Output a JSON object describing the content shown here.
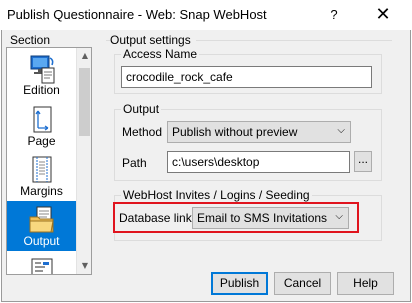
{
  "window": {
    "title": "Publish Questionnaire - Web: Snap WebHost",
    "help_glyph": "?",
    "close_glyph": "✕"
  },
  "sidebar": {
    "heading": "Section",
    "items": [
      {
        "label": "Edition",
        "icon": "edition-icon",
        "selected": false
      },
      {
        "label": "Page",
        "icon": "page-icon",
        "selected": false
      },
      {
        "label": "Margins",
        "icon": "margins-icon",
        "selected": false
      },
      {
        "label": "Output",
        "icon": "output-folder-icon",
        "selected": true
      },
      {
        "label": "",
        "icon": "form-icon",
        "selected": false
      }
    ]
  },
  "output_settings": {
    "heading": "Output settings",
    "access_name": {
      "label": "Access Name",
      "value": "crocodile_rock_cafe"
    },
    "output": {
      "label": "Output",
      "method_label": "Method",
      "method_value": "Publish without preview",
      "path_label": "Path",
      "path_value": "c:\\users\\desktop",
      "browse_label": "..."
    },
    "webhost": {
      "label": "WebHost Invites / Logins / Seeding",
      "database_link_label": "Database link",
      "database_link_value": "Email to SMS Invitations"
    }
  },
  "buttons": {
    "publish": "Publish",
    "cancel": "Cancel",
    "help": "Help"
  },
  "colors": {
    "selection": "#0078d7",
    "highlight_box": "#e0141e",
    "dialog_bg": "#f0f0f0"
  }
}
